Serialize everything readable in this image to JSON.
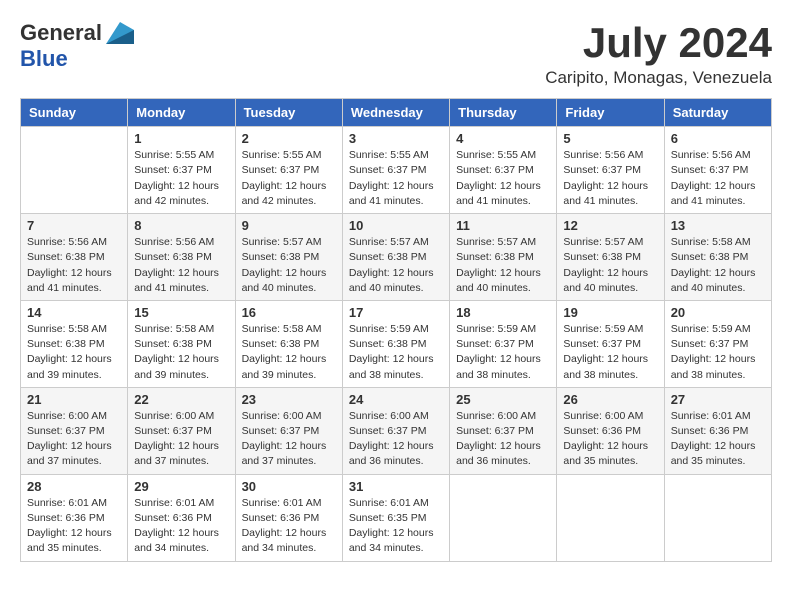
{
  "logo": {
    "general": "General",
    "blue": "Blue"
  },
  "title": {
    "month_year": "July 2024",
    "location": "Caripito, Monagas, Venezuela"
  },
  "calendar": {
    "headers": [
      "Sunday",
      "Monday",
      "Tuesday",
      "Wednesday",
      "Thursday",
      "Friday",
      "Saturday"
    ],
    "weeks": [
      [
        {
          "day": "",
          "sunrise": "",
          "sunset": "",
          "daylight": ""
        },
        {
          "day": "1",
          "sunrise": "Sunrise: 5:55 AM",
          "sunset": "Sunset: 6:37 PM",
          "daylight": "Daylight: 12 hours and 42 minutes."
        },
        {
          "day": "2",
          "sunrise": "Sunrise: 5:55 AM",
          "sunset": "Sunset: 6:37 PM",
          "daylight": "Daylight: 12 hours and 42 minutes."
        },
        {
          "day": "3",
          "sunrise": "Sunrise: 5:55 AM",
          "sunset": "Sunset: 6:37 PM",
          "daylight": "Daylight: 12 hours and 41 minutes."
        },
        {
          "day": "4",
          "sunrise": "Sunrise: 5:55 AM",
          "sunset": "Sunset: 6:37 PM",
          "daylight": "Daylight: 12 hours and 41 minutes."
        },
        {
          "day": "5",
          "sunrise": "Sunrise: 5:56 AM",
          "sunset": "Sunset: 6:37 PM",
          "daylight": "Daylight: 12 hours and 41 minutes."
        },
        {
          "day": "6",
          "sunrise": "Sunrise: 5:56 AM",
          "sunset": "Sunset: 6:37 PM",
          "daylight": "Daylight: 12 hours and 41 minutes."
        }
      ],
      [
        {
          "day": "7",
          "sunrise": "Sunrise: 5:56 AM",
          "sunset": "Sunset: 6:38 PM",
          "daylight": "Daylight: 12 hours and 41 minutes."
        },
        {
          "day": "8",
          "sunrise": "Sunrise: 5:56 AM",
          "sunset": "Sunset: 6:38 PM",
          "daylight": "Daylight: 12 hours and 41 minutes."
        },
        {
          "day": "9",
          "sunrise": "Sunrise: 5:57 AM",
          "sunset": "Sunset: 6:38 PM",
          "daylight": "Daylight: 12 hours and 40 minutes."
        },
        {
          "day": "10",
          "sunrise": "Sunrise: 5:57 AM",
          "sunset": "Sunset: 6:38 PM",
          "daylight": "Daylight: 12 hours and 40 minutes."
        },
        {
          "day": "11",
          "sunrise": "Sunrise: 5:57 AM",
          "sunset": "Sunset: 6:38 PM",
          "daylight": "Daylight: 12 hours and 40 minutes."
        },
        {
          "day": "12",
          "sunrise": "Sunrise: 5:57 AM",
          "sunset": "Sunset: 6:38 PM",
          "daylight": "Daylight: 12 hours and 40 minutes."
        },
        {
          "day": "13",
          "sunrise": "Sunrise: 5:58 AM",
          "sunset": "Sunset: 6:38 PM",
          "daylight": "Daylight: 12 hours and 40 minutes."
        }
      ],
      [
        {
          "day": "14",
          "sunrise": "Sunrise: 5:58 AM",
          "sunset": "Sunset: 6:38 PM",
          "daylight": "Daylight: 12 hours and 39 minutes."
        },
        {
          "day": "15",
          "sunrise": "Sunrise: 5:58 AM",
          "sunset": "Sunset: 6:38 PM",
          "daylight": "Daylight: 12 hours and 39 minutes."
        },
        {
          "day": "16",
          "sunrise": "Sunrise: 5:58 AM",
          "sunset": "Sunset: 6:38 PM",
          "daylight": "Daylight: 12 hours and 39 minutes."
        },
        {
          "day": "17",
          "sunrise": "Sunrise: 5:59 AM",
          "sunset": "Sunset: 6:38 PM",
          "daylight": "Daylight: 12 hours and 38 minutes."
        },
        {
          "day": "18",
          "sunrise": "Sunrise: 5:59 AM",
          "sunset": "Sunset: 6:37 PM",
          "daylight": "Daylight: 12 hours and 38 minutes."
        },
        {
          "day": "19",
          "sunrise": "Sunrise: 5:59 AM",
          "sunset": "Sunset: 6:37 PM",
          "daylight": "Daylight: 12 hours and 38 minutes."
        },
        {
          "day": "20",
          "sunrise": "Sunrise: 5:59 AM",
          "sunset": "Sunset: 6:37 PM",
          "daylight": "Daylight: 12 hours and 38 minutes."
        }
      ],
      [
        {
          "day": "21",
          "sunrise": "Sunrise: 6:00 AM",
          "sunset": "Sunset: 6:37 PM",
          "daylight": "Daylight: 12 hours and 37 minutes."
        },
        {
          "day": "22",
          "sunrise": "Sunrise: 6:00 AM",
          "sunset": "Sunset: 6:37 PM",
          "daylight": "Daylight: 12 hours and 37 minutes."
        },
        {
          "day": "23",
          "sunrise": "Sunrise: 6:00 AM",
          "sunset": "Sunset: 6:37 PM",
          "daylight": "Daylight: 12 hours and 37 minutes."
        },
        {
          "day": "24",
          "sunrise": "Sunrise: 6:00 AM",
          "sunset": "Sunset: 6:37 PM",
          "daylight": "Daylight: 12 hours and 36 minutes."
        },
        {
          "day": "25",
          "sunrise": "Sunrise: 6:00 AM",
          "sunset": "Sunset: 6:37 PM",
          "daylight": "Daylight: 12 hours and 36 minutes."
        },
        {
          "day": "26",
          "sunrise": "Sunrise: 6:00 AM",
          "sunset": "Sunset: 6:36 PM",
          "daylight": "Daylight: 12 hours and 35 minutes."
        },
        {
          "day": "27",
          "sunrise": "Sunrise: 6:01 AM",
          "sunset": "Sunset: 6:36 PM",
          "daylight": "Daylight: 12 hours and 35 minutes."
        }
      ],
      [
        {
          "day": "28",
          "sunrise": "Sunrise: 6:01 AM",
          "sunset": "Sunset: 6:36 PM",
          "daylight": "Daylight: 12 hours and 35 minutes."
        },
        {
          "day": "29",
          "sunrise": "Sunrise: 6:01 AM",
          "sunset": "Sunset: 6:36 PM",
          "daylight": "Daylight: 12 hours and 34 minutes."
        },
        {
          "day": "30",
          "sunrise": "Sunrise: 6:01 AM",
          "sunset": "Sunset: 6:36 PM",
          "daylight": "Daylight: 12 hours and 34 minutes."
        },
        {
          "day": "31",
          "sunrise": "Sunrise: 6:01 AM",
          "sunset": "Sunset: 6:35 PM",
          "daylight": "Daylight: 12 hours and 34 minutes."
        },
        {
          "day": "",
          "sunrise": "",
          "sunset": "",
          "daylight": ""
        },
        {
          "day": "",
          "sunrise": "",
          "sunset": "",
          "daylight": ""
        },
        {
          "day": "",
          "sunrise": "",
          "sunset": "",
          "daylight": ""
        }
      ]
    ]
  }
}
